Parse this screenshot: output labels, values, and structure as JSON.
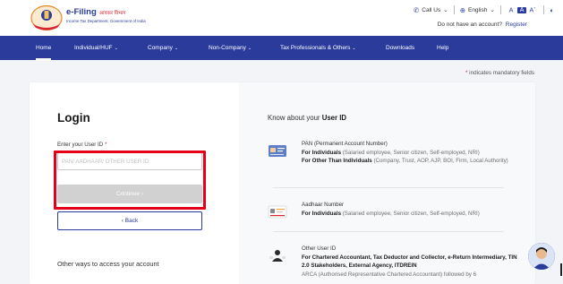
{
  "header": {
    "brand_title": "e-Filing",
    "brand_hindi": "आयकर विभाग",
    "brand_subtitle": "Income Tax Department, Government of India",
    "call_us": "Call Us",
    "language": "English",
    "font_small": "A",
    "font_normal": "A",
    "font_large": "A",
    "no_account_text": "Do not have an account?",
    "register_link": "Register"
  },
  "nav": {
    "items": [
      {
        "label": "Home",
        "caret": false
      },
      {
        "label": "Individual/HUF",
        "caret": true
      },
      {
        "label": "Company",
        "caret": true
      },
      {
        "label": "Non-Company",
        "caret": true
      },
      {
        "label": "Tax Professionals & Others",
        "caret": true
      },
      {
        "label": "Downloads",
        "caret": false
      },
      {
        "label": "Help",
        "caret": false
      }
    ],
    "caret_glyph": "⌄"
  },
  "mandatory_note": {
    "star": "*",
    "text": " indicates mandatory fields"
  },
  "login": {
    "title": "Login",
    "user_id_label": "Enter your User ID",
    "required_star": "*",
    "user_id_placeholder": "PAN/ AADHAAR/ OTHER USER ID",
    "user_id_value": "",
    "continue_label": "Continue  ›",
    "back_label": "‹ Back",
    "other_ways": "Other ways to access your account"
  },
  "know": {
    "title_prefix": "Know about your ",
    "title_bold": "User ID",
    "items": [
      {
        "icon": "pan-card-icon",
        "title": "PAN (Permanent Account Number)",
        "line1_bold": "For Individuals",
        "line1_muted": " (Salaried employee, Senior citizen, Self-employed, NRI)",
        "line2_bold": "For Other Than Individuals",
        "line2_muted": " (Company, Trust, AOP, AJP, BOI, Firm, Local Authority)"
      },
      {
        "icon": "aadhaar-card-icon",
        "title": "Aadhaar Number",
        "line1_bold": "For Individuals",
        "line1_muted": " (Salaried employee, Senior citizen, Self-employed, NRI)"
      },
      {
        "icon": "other-user-id-icon",
        "title": "Other User ID",
        "line1_bold": "For Chartered Accountant, Tax Deductor and Collector, e-Return Intermediary, TIN 2.0 Stakeholders, External Agency, ITDREIN",
        "line2_muted": "ARCA (Authorised Representative Chartered Accountant) followed by 6"
      }
    ]
  },
  "colors": {
    "brand_blue": "#2a3b9c",
    "accent_red": "#d9232e",
    "highlight_red": "#e5001a",
    "disabled_button": "#d1d1d1"
  },
  "chatbot": {
    "icon": "chatbot-avatar-icon"
  }
}
